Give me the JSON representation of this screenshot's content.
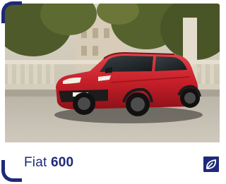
{
  "card": {
    "brand": "Fiat",
    "model": "600",
    "image_alt_icon": "car-photo",
    "badge_icon": "leaf-icon"
  },
  "colors": {
    "accent": "#1e2a78",
    "car_body": "#c8202a"
  }
}
